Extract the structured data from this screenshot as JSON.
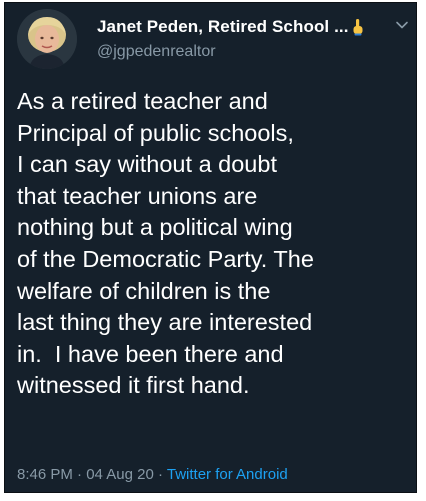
{
  "tweet": {
    "display_name": "Janet Peden, Retired School ...",
    "handle": "@jgpedenrealtor",
    "body_lines": [
      "As a retired teacher and",
      "Principal of public schools,",
      "I can say without a doubt",
      "that teacher unions are",
      "nothing but a political wing",
      "of the Democratic Party. The",
      "welfare of children is the",
      "last thing they are interested",
      "in.  I have been there and",
      "witnessed it first hand."
    ],
    "time": "8:46 PM",
    "separator": " · ",
    "date": "04 Aug 20",
    "app": "Twitter for Android"
  },
  "icons": {
    "name_emoji": "pointing-finger-icon",
    "menu": "chevron-down-icon",
    "avatar": "avatar"
  },
  "colors": {
    "background": "#15202b",
    "text": "#ffffff",
    "muted": "#8899a6",
    "link": "#1da1f2"
  }
}
